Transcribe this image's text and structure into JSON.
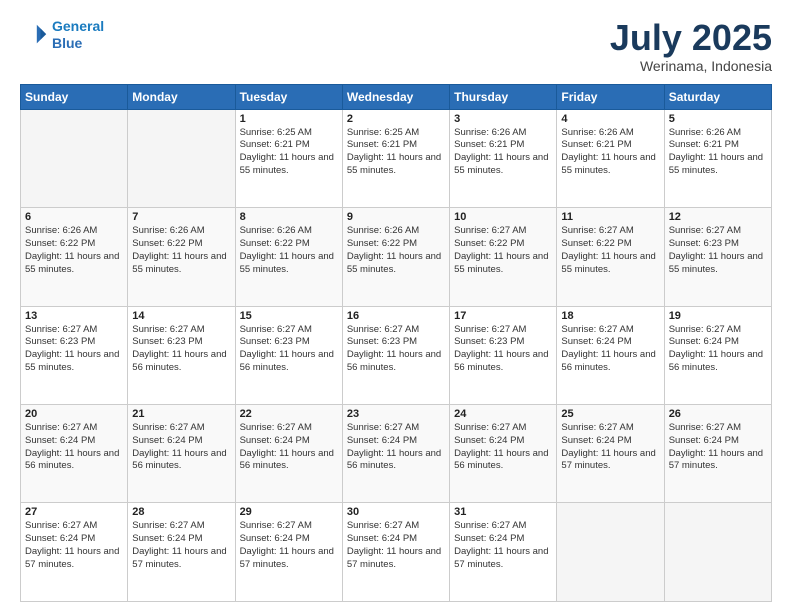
{
  "header": {
    "logo_line1": "General",
    "logo_line2": "Blue",
    "month": "July 2025",
    "location": "Werinama, Indonesia"
  },
  "days_of_week": [
    "Sunday",
    "Monday",
    "Tuesday",
    "Wednesday",
    "Thursday",
    "Friday",
    "Saturday"
  ],
  "weeks": [
    [
      {
        "day": "",
        "empty": true
      },
      {
        "day": "",
        "empty": true
      },
      {
        "day": "1",
        "sunrise": "Sunrise: 6:25 AM",
        "sunset": "Sunset: 6:21 PM",
        "daylight": "Daylight: 11 hours and 55 minutes."
      },
      {
        "day": "2",
        "sunrise": "Sunrise: 6:25 AM",
        "sunset": "Sunset: 6:21 PM",
        "daylight": "Daylight: 11 hours and 55 minutes."
      },
      {
        "day": "3",
        "sunrise": "Sunrise: 6:26 AM",
        "sunset": "Sunset: 6:21 PM",
        "daylight": "Daylight: 11 hours and 55 minutes."
      },
      {
        "day": "4",
        "sunrise": "Sunrise: 6:26 AM",
        "sunset": "Sunset: 6:21 PM",
        "daylight": "Daylight: 11 hours and 55 minutes."
      },
      {
        "day": "5",
        "sunrise": "Sunrise: 6:26 AM",
        "sunset": "Sunset: 6:21 PM",
        "daylight": "Daylight: 11 hours and 55 minutes."
      }
    ],
    [
      {
        "day": "6",
        "sunrise": "Sunrise: 6:26 AM",
        "sunset": "Sunset: 6:22 PM",
        "daylight": "Daylight: 11 hours and 55 minutes."
      },
      {
        "day": "7",
        "sunrise": "Sunrise: 6:26 AM",
        "sunset": "Sunset: 6:22 PM",
        "daylight": "Daylight: 11 hours and 55 minutes."
      },
      {
        "day": "8",
        "sunrise": "Sunrise: 6:26 AM",
        "sunset": "Sunset: 6:22 PM",
        "daylight": "Daylight: 11 hours and 55 minutes."
      },
      {
        "day": "9",
        "sunrise": "Sunrise: 6:26 AM",
        "sunset": "Sunset: 6:22 PM",
        "daylight": "Daylight: 11 hours and 55 minutes."
      },
      {
        "day": "10",
        "sunrise": "Sunrise: 6:27 AM",
        "sunset": "Sunset: 6:22 PM",
        "daylight": "Daylight: 11 hours and 55 minutes."
      },
      {
        "day": "11",
        "sunrise": "Sunrise: 6:27 AM",
        "sunset": "Sunset: 6:22 PM",
        "daylight": "Daylight: 11 hours and 55 minutes."
      },
      {
        "day": "12",
        "sunrise": "Sunrise: 6:27 AM",
        "sunset": "Sunset: 6:23 PM",
        "daylight": "Daylight: 11 hours and 55 minutes."
      }
    ],
    [
      {
        "day": "13",
        "sunrise": "Sunrise: 6:27 AM",
        "sunset": "Sunset: 6:23 PM",
        "daylight": "Daylight: 11 hours and 55 minutes."
      },
      {
        "day": "14",
        "sunrise": "Sunrise: 6:27 AM",
        "sunset": "Sunset: 6:23 PM",
        "daylight": "Daylight: 11 hours and 56 minutes."
      },
      {
        "day": "15",
        "sunrise": "Sunrise: 6:27 AM",
        "sunset": "Sunset: 6:23 PM",
        "daylight": "Daylight: 11 hours and 56 minutes."
      },
      {
        "day": "16",
        "sunrise": "Sunrise: 6:27 AM",
        "sunset": "Sunset: 6:23 PM",
        "daylight": "Daylight: 11 hours and 56 minutes."
      },
      {
        "day": "17",
        "sunrise": "Sunrise: 6:27 AM",
        "sunset": "Sunset: 6:23 PM",
        "daylight": "Daylight: 11 hours and 56 minutes."
      },
      {
        "day": "18",
        "sunrise": "Sunrise: 6:27 AM",
        "sunset": "Sunset: 6:24 PM",
        "daylight": "Daylight: 11 hours and 56 minutes."
      },
      {
        "day": "19",
        "sunrise": "Sunrise: 6:27 AM",
        "sunset": "Sunset: 6:24 PM",
        "daylight": "Daylight: 11 hours and 56 minutes."
      }
    ],
    [
      {
        "day": "20",
        "sunrise": "Sunrise: 6:27 AM",
        "sunset": "Sunset: 6:24 PM",
        "daylight": "Daylight: 11 hours and 56 minutes."
      },
      {
        "day": "21",
        "sunrise": "Sunrise: 6:27 AM",
        "sunset": "Sunset: 6:24 PM",
        "daylight": "Daylight: 11 hours and 56 minutes."
      },
      {
        "day": "22",
        "sunrise": "Sunrise: 6:27 AM",
        "sunset": "Sunset: 6:24 PM",
        "daylight": "Daylight: 11 hours and 56 minutes."
      },
      {
        "day": "23",
        "sunrise": "Sunrise: 6:27 AM",
        "sunset": "Sunset: 6:24 PM",
        "daylight": "Daylight: 11 hours and 56 minutes."
      },
      {
        "day": "24",
        "sunrise": "Sunrise: 6:27 AM",
        "sunset": "Sunset: 6:24 PM",
        "daylight": "Daylight: 11 hours and 56 minutes."
      },
      {
        "day": "25",
        "sunrise": "Sunrise: 6:27 AM",
        "sunset": "Sunset: 6:24 PM",
        "daylight": "Daylight: 11 hours and 57 minutes."
      },
      {
        "day": "26",
        "sunrise": "Sunrise: 6:27 AM",
        "sunset": "Sunset: 6:24 PM",
        "daylight": "Daylight: 11 hours and 57 minutes."
      }
    ],
    [
      {
        "day": "27",
        "sunrise": "Sunrise: 6:27 AM",
        "sunset": "Sunset: 6:24 PM",
        "daylight": "Daylight: 11 hours and 57 minutes."
      },
      {
        "day": "28",
        "sunrise": "Sunrise: 6:27 AM",
        "sunset": "Sunset: 6:24 PM",
        "daylight": "Daylight: 11 hours and 57 minutes."
      },
      {
        "day": "29",
        "sunrise": "Sunrise: 6:27 AM",
        "sunset": "Sunset: 6:24 PM",
        "daylight": "Daylight: 11 hours and 57 minutes."
      },
      {
        "day": "30",
        "sunrise": "Sunrise: 6:27 AM",
        "sunset": "Sunset: 6:24 PM",
        "daylight": "Daylight: 11 hours and 57 minutes."
      },
      {
        "day": "31",
        "sunrise": "Sunrise: 6:27 AM",
        "sunset": "Sunset: 6:24 PM",
        "daylight": "Daylight: 11 hours and 57 minutes."
      },
      {
        "day": "",
        "empty": true
      },
      {
        "day": "",
        "empty": true
      }
    ]
  ]
}
